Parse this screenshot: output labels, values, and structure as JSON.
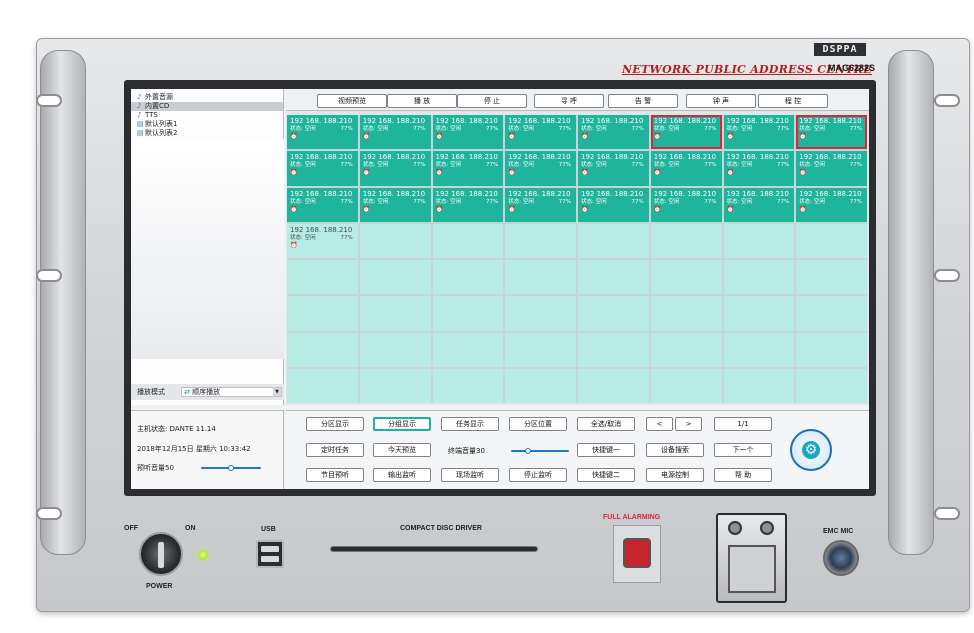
{
  "brand": {
    "logo": "DSPPA",
    "tagline": "NETWORK PUBLIC ADDRESS CENTRE",
    "model": "MAG6282S"
  },
  "sidebar": {
    "items": [
      {
        "label": "外置音源",
        "icon": "speaker-icon"
      },
      {
        "label": "内置CD",
        "icon": "speaker-icon"
      },
      {
        "label": "TTS",
        "icon": "speaker-icon"
      },
      {
        "label": "默认列表1",
        "icon": "playlist-icon"
      },
      {
        "label": "默认列表2",
        "icon": "playlist-icon"
      }
    ],
    "selected_index": 1,
    "play_mode_label": "播放模式",
    "play_mode_value": "顺序播放"
  },
  "status": {
    "host_state": "主机状态: DANTE 11.14",
    "datetime": "2018年12月15日 星期六 10:33:42",
    "preview_volume": "预听音量50",
    "preview_volume_level": 0.5
  },
  "top_tabs": [
    "视频预览",
    "播 放",
    "停 止",
    "寻 呼",
    "告 警",
    "钟 声",
    "程 控"
  ],
  "terminal": {
    "ip": "192 168. 188.210",
    "state": "状态: 空闲",
    "volume": "77%"
  },
  "grid": {
    "active_count": 25,
    "warn_indices": [
      5,
      7
    ],
    "idle_index": 24,
    "total_cells": 64
  },
  "bottom_buttons": {
    "row1": [
      "分区显示",
      "分组显示",
      "任务显示",
      "分区位置",
      "全选/取消",
      "<",
      ">",
      "1/1"
    ],
    "row2": [
      "定时任务",
      "今天预览",
      "快捷键一",
      "设备搜索",
      "下一个"
    ],
    "row3": [
      "节目预听",
      "输出监听",
      "现场监听",
      "停止监听",
      "快捷键二",
      "电源控制",
      "帮 助"
    ],
    "terminal_volume_label": "终端音量30",
    "terminal_volume_level": 0.3,
    "active_button": "分组显示"
  },
  "hardware": {
    "off_label": "OFF",
    "on_label": "ON",
    "power_label": "POWER",
    "usb_label": "USB",
    "cd_label": "COMPACT DISC DRIVER",
    "alarm_label": "FULL ALARMING",
    "mic_label": "EMC MIC"
  },
  "colors": {
    "terminal_active": "#1fb49c",
    "terminal_warning_border": "#d6283a",
    "grid_empty": "#b7ebe5",
    "alarm_label": "#d6283a"
  }
}
